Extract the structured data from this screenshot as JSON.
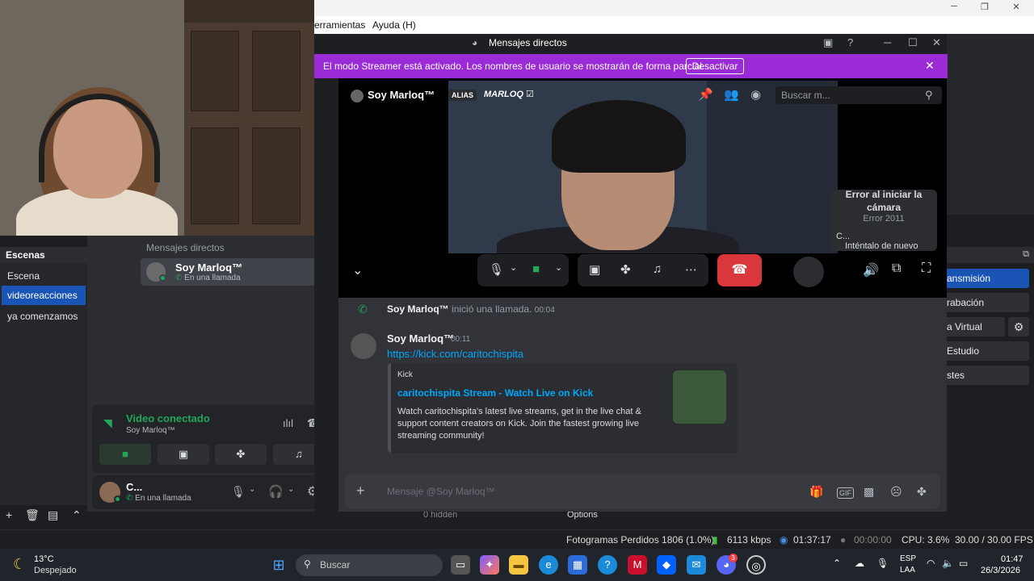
{
  "obs": {
    "menu": [
      "erramientas",
      "Ayuda (H)"
    ],
    "scenes_title": "Escenas",
    "scenes": [
      "Escena",
      "videoreacciones",
      "ya comenzamos"
    ],
    "selected_scene": "videoreacciones",
    "controls": [
      "ansmisión",
      "rabación",
      "a Virtual",
      "Estudio",
      "stes"
    ],
    "bottom_strip": [
      "0 hidden",
      "Options"
    ],
    "status": {
      "dropped": "Fotogramas Perdidos 1806 (1.0%)",
      "bitrate": "6113 kbps",
      "stream_time": "01:37:17",
      "rec_time": "00:00:00",
      "cpu": "CPU: 3.6%",
      "fps": "30.00 / 30.00 FPS"
    }
  },
  "discord": {
    "window_title": "Mensajes directos",
    "notification_count": "1",
    "banner_text": "El modo Streamer está activado. Los nombres de usuario se mostrarán de forma parcial.",
    "banner_button": "Desactivar",
    "dm_header": "Mensajes directos",
    "dm_item": {
      "name": "Soy Marloq™",
      "status": "En una llamada"
    },
    "voice": {
      "title": "Video conectado",
      "subtitle": "Soy Marloq™"
    },
    "user": {
      "name": "C...",
      "status": "En una llamada"
    },
    "call": {
      "name": "Soy Marloq™",
      "alias_badge": "ALIAS",
      "alias_name": "MARLOQ ☑",
      "search_placeholder": "Buscar m...",
      "error_title": "Error al iniciar la cámara",
      "error_code": "Error 2011",
      "error_short": "C...",
      "retry": "Inténtalo de nuevo"
    },
    "messages": {
      "system_author": "Soy Marloq™",
      "system_text": "inició una llamada.",
      "system_time": "00:04",
      "author": "Soy Marloq™",
      "time": "00:11",
      "link": "https://kick.com/caritochispita",
      "embed_provider": "Kick",
      "embed_title": "caritochispita Stream - Watch Live on Kick",
      "embed_desc": "Watch caritochispita's latest live streams, get in the live chat & support content creators on Kick. Join the fastest growing live streaming community!"
    },
    "input_placeholder": "Mensaje @Soy Marloq™"
  },
  "taskbar": {
    "weather_temp": "13°C",
    "weather_desc": "Despejado",
    "search": "Buscar",
    "discord_badge": "3",
    "lang1": "ESP",
    "lang2": "LAA",
    "time": "01:47",
    "date": "26/3/2026"
  },
  "colors": {
    "streamer_banner": "#9b2bd6",
    "hangup": "#da373c",
    "online": "#23a55a",
    "link": "#00a8fc",
    "obs_selected": "#1a54b5"
  }
}
